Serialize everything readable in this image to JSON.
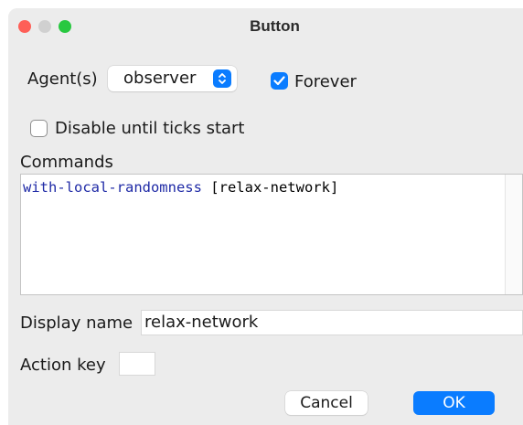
{
  "window": {
    "title": "Button"
  },
  "agents": {
    "label": "Agent(s)",
    "selected": "observer"
  },
  "forever": {
    "label": "Forever",
    "checked": true
  },
  "disable_until_ticks": {
    "label": "Disable until ticks start",
    "checked": false
  },
  "commands": {
    "label": "Commands",
    "code_primitive": "with-local-randomness",
    "code_rest": " [relax-network]"
  },
  "display_name": {
    "label": "Display name",
    "value": "relax-network"
  },
  "action_key": {
    "label": "Action key",
    "value": ""
  },
  "buttons": {
    "cancel": "Cancel",
    "ok": "OK"
  },
  "colors": {
    "accent": "#0a7cff",
    "close": "#fe5f57",
    "minimize_disabled": "#d0d0d0",
    "zoom": "#28c840",
    "primitive": "#1f2aa6"
  }
}
